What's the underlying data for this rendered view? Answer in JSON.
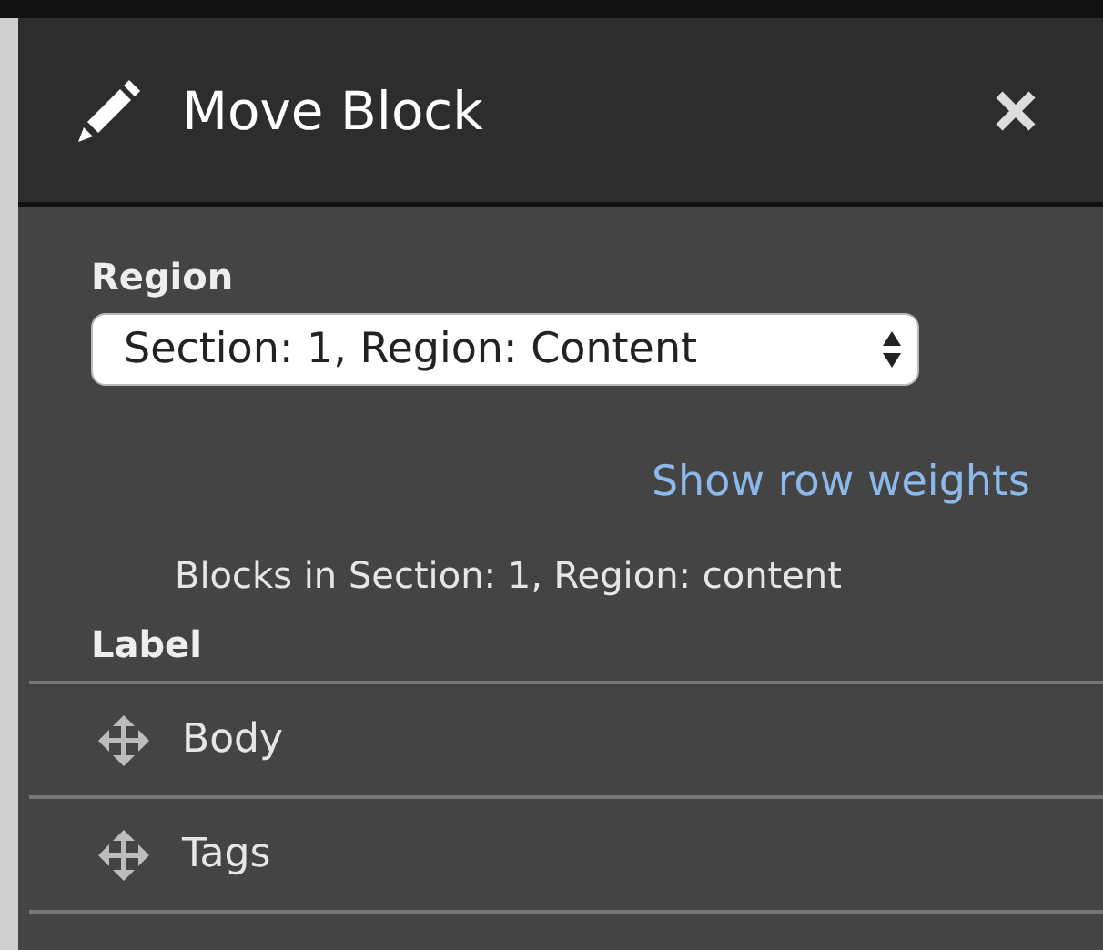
{
  "dialog": {
    "title": "Move Block"
  },
  "region": {
    "label": "Region",
    "value": "Section: 1, Region: Content"
  },
  "link": "Show row weights",
  "caption": "Blocks in Section: 1, Region: content",
  "table": {
    "columns": [
      "Label"
    ],
    "rows": [
      {
        "label": "Body"
      },
      {
        "label": "Tags"
      }
    ]
  }
}
